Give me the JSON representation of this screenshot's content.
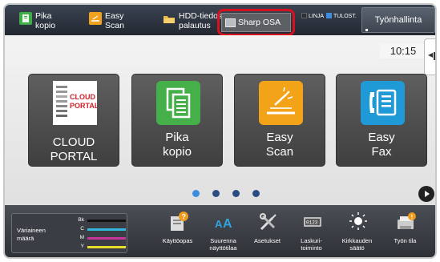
{
  "topbar": {
    "items": [
      {
        "line1": "Pika",
        "line2": "kopio",
        "icon": "quick-copy-icon"
      },
      {
        "line1": "Easy",
        "line2": "Scan",
        "icon": "easy-scan-icon"
      },
      {
        "line1": "HDD-tiedos",
        "line2": "palautus",
        "icon": "hdd-folder-icon"
      }
    ],
    "osa_label": "Sharp OSA",
    "status_line": "LINJA",
    "status_print": "TULOST.",
    "jobs_label": "Työnhallinta"
  },
  "clock": "10:15",
  "tiles": [
    {
      "line1": "CLOUD PORTAL",
      "line2": "",
      "icon": "cloud-portal-icon",
      "logo_text1": "CLOUD",
      "logo_text2": "PORTAL"
    },
    {
      "line1": "Pika",
      "line2": "kopio",
      "icon": "quick-copy-icon"
    },
    {
      "line1": "Easy",
      "line2": "Scan",
      "icon": "easy-scan-icon"
    },
    {
      "line1": "Easy",
      "line2": "Fax",
      "icon": "easy-fax-icon"
    }
  ],
  "pager": {
    "pages": 4,
    "current": 1
  },
  "bottombar": {
    "toner_title1": "Väriaineen",
    "toner_title2": "määrä",
    "toner": [
      {
        "label": "Bk",
        "color": "#111111",
        "level": 1.0
      },
      {
        "label": "C",
        "color": "#2fb8d8",
        "level": 1.0
      },
      {
        "label": "M",
        "color": "#c8359b",
        "level": 1.0
      },
      {
        "label": "Y",
        "color": "#e8dd2c",
        "level": 1.0
      }
    ],
    "items": [
      {
        "line1": "Käyttöopas",
        "line2": "",
        "icon": "manual-icon"
      },
      {
        "line1": "Suurenna",
        "line2": "näyttötilaa",
        "icon": "magnify-display-icon"
      },
      {
        "line1": "Asetukset",
        "line2": "",
        "icon": "settings-icon"
      },
      {
        "line1": "Laskuri-",
        "line2": "toiminto",
        "icon": "counter-icon"
      },
      {
        "line1": "Kirkkauden",
        "line2": "säätö",
        "icon": "brightness-icon"
      },
      {
        "line1": "Työn tila",
        "line2": "",
        "icon": "job-status-icon"
      }
    ]
  },
  "colors": {
    "highlight": "#d7111f",
    "dot_active": "#3c8ce0"
  }
}
